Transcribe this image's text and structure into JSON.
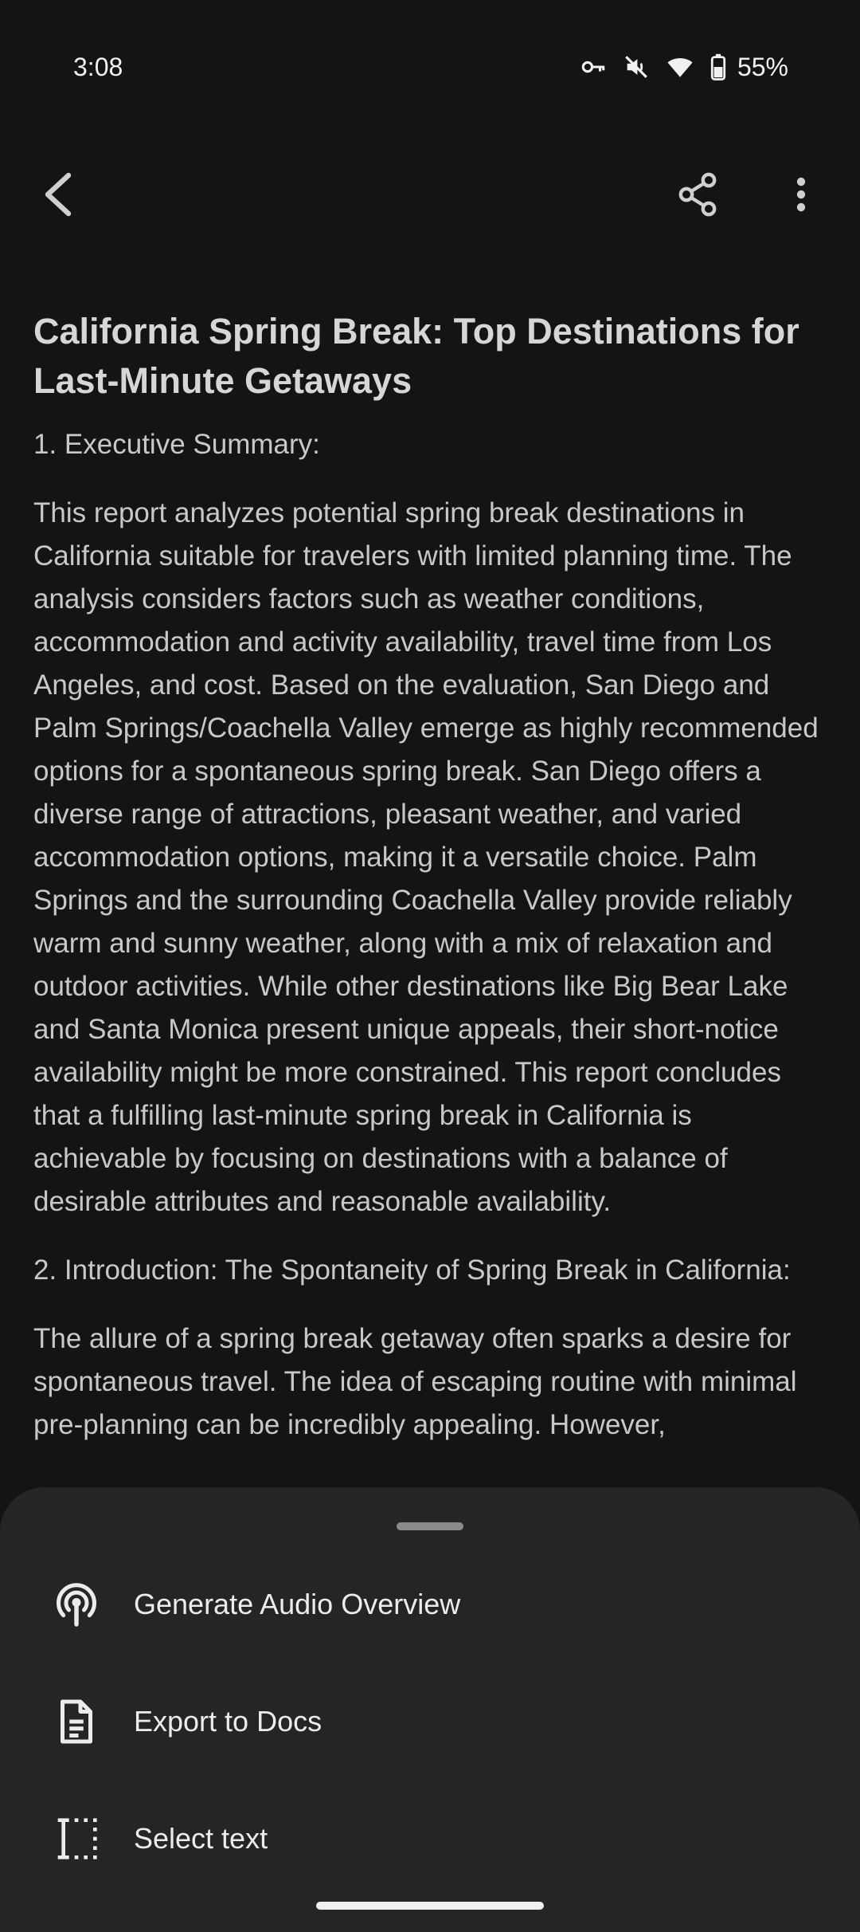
{
  "status_bar": {
    "time": "3:08",
    "battery_percent": "55%",
    "icons": [
      "vpn-key-icon",
      "mute-icon",
      "wifi-icon",
      "battery-icon"
    ]
  },
  "app_bar": {
    "back_icon": "arrow-back-icon",
    "share_icon": "share-icon",
    "more_icon": "more-vert-icon"
  },
  "document": {
    "title": "California Spring Break: Top Destinations for Last-Minute Getaways",
    "sections": [
      {
        "heading": "1. Executive Summary:",
        "body": "This report analyzes potential spring break destinations in California suitable for travelers with limited planning time. The analysis considers factors such as weather conditions, accommodation and activity availability, travel time from Los Angeles, and cost. Based on the evaluation, San Diego and Palm Springs/Coachella Valley emerge as highly recommended options for a spontaneous spring break. San Diego offers a diverse range of attractions, pleasant weather, and varied accommodation options, making it a versatile choice. Palm Springs and the surrounding Coachella Valley provide reliably warm and sunny weather, along with a mix of relaxation and outdoor activities. While other destinations like Big Bear Lake and Santa Monica present unique appeals, their short-notice availability might be more constrained. This report concludes that a fulfilling last-minute spring break in California is achievable by focusing on destinations with a balance of desirable attributes and reasonable availability."
      },
      {
        "heading": "2. Introduction: The Spontaneity of Spring Break in California:",
        "body": "The allure of a spring break getaway often sparks a desire for spontaneous travel. The idea of escaping routine with minimal pre-planning can be incredibly appealing. However,"
      }
    ]
  },
  "bottom_sheet": {
    "items": [
      {
        "label": "Generate Audio Overview",
        "icon": "podcast-icon"
      },
      {
        "label": "Export to Docs",
        "icon": "document-icon"
      },
      {
        "label": "Select text",
        "icon": "text-select-icon"
      }
    ]
  },
  "colors": {
    "background": "#131416",
    "sheet": "#242527",
    "text": "#c8c8c8",
    "title": "#d6d6d6"
  }
}
